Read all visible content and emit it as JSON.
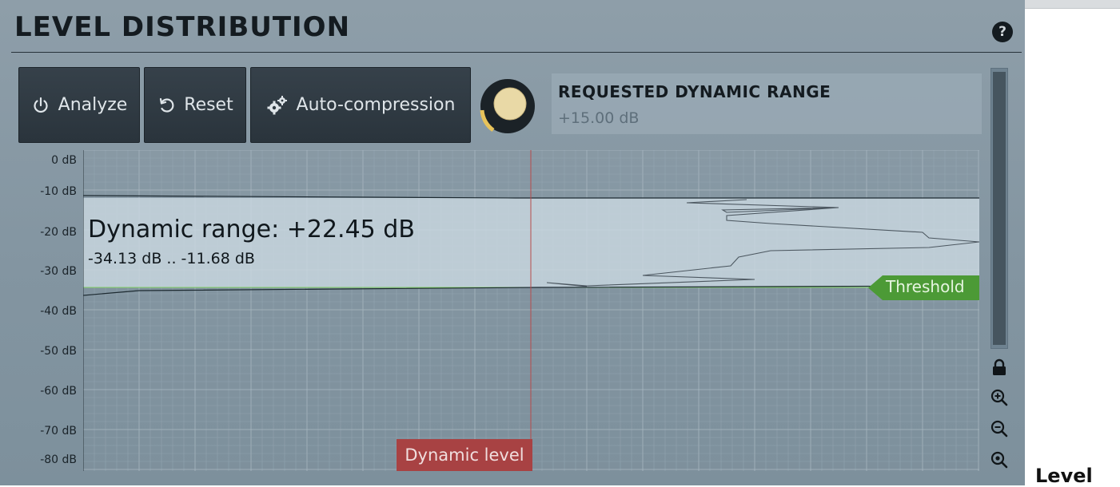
{
  "page": {
    "title": "LEVEL DISTRIBUTION",
    "help_label": "?",
    "outside_heading": "Level"
  },
  "buttons": {
    "analyze": "Analyze",
    "reset": "Reset",
    "auto_compression": "Auto-compression"
  },
  "param": {
    "title": "REQUESTED DYNAMIC RANGE",
    "value": "+15.00 dB",
    "knob_level": 0.25
  },
  "graph": {
    "y_labels": [
      "0 dB",
      "-10 dB",
      "-20 dB",
      "-30 dB",
      "-40 dB",
      "-50 dB",
      "-60 dB",
      "-70 dB",
      "-80 dB"
    ],
    "dynamic_range_label": "Dynamic range: +22.45 dB",
    "range_text": "-34.13 dB .. -11.68 dB",
    "threshold_label": "Threshold",
    "dynamic_level_label": "Dynamic level",
    "band_top_db": -11.68,
    "band_bottom_db": -34.13,
    "dynamic_level_fraction": 0.5
  },
  "icons": {
    "power": "power-icon",
    "reset": "reset-icon",
    "gears": "gears-icon",
    "lock": "lock-icon",
    "zoom_in": "zoom-in-icon",
    "zoom_out": "zoom-out-icon",
    "zoom_fit": "zoom-fit-icon"
  },
  "colors": {
    "accent_threshold": "#4c9a36",
    "dynamic_level": "#a84243",
    "knob_face": "#e9d9a6",
    "knob_arc": "#e8c35a"
  }
}
